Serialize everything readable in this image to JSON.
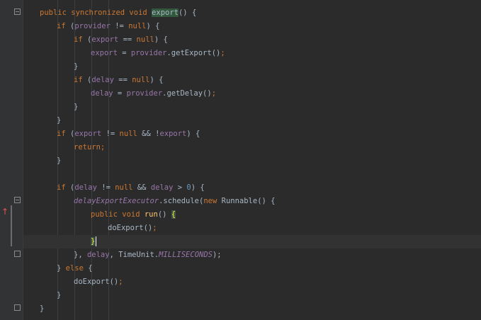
{
  "editor": {
    "colors": {
      "background": "#2b2b2b",
      "keyword": "#cc7832",
      "field": "#9876aa",
      "number": "#6897bb",
      "plain": "#a9b7c6",
      "highlight": "#32593d"
    },
    "gutter_icons": [
      "fold-marker-icon",
      "override-method-icon"
    ],
    "lines": [
      [
        {
          "t": "public synchronized void ",
          "c": "keyword"
        },
        {
          "t": "export",
          "c": "highlight"
        },
        {
          "t": "() {",
          "c": "plain"
        }
      ],
      [
        {
          "t": "if",
          "c": "keyword"
        },
        {
          "t": " (",
          "c": "plain"
        },
        {
          "t": "provider",
          "c": "field"
        },
        {
          "t": " != ",
          "c": "plain"
        },
        {
          "t": "null",
          "c": "keyword"
        },
        {
          "t": ") {",
          "c": "plain"
        }
      ],
      [
        {
          "t": "if",
          "c": "keyword"
        },
        {
          "t": " (",
          "c": "plain"
        },
        {
          "t": "export",
          "c": "field"
        },
        {
          "t": " == ",
          "c": "plain"
        },
        {
          "t": "null",
          "c": "keyword"
        },
        {
          "t": ") {",
          "c": "plain"
        }
      ],
      [
        {
          "t": "export",
          "c": "field"
        },
        {
          "t": " = ",
          "c": "plain"
        },
        {
          "t": "provider",
          "c": "field"
        },
        {
          "t": ".getExport()",
          "c": "plain"
        },
        {
          "t": ";",
          "c": "keyword"
        }
      ],
      [
        {
          "t": "}",
          "c": "plain"
        }
      ],
      [
        {
          "t": "if",
          "c": "keyword"
        },
        {
          "t": " (",
          "c": "plain"
        },
        {
          "t": "delay",
          "c": "field"
        },
        {
          "t": " == ",
          "c": "plain"
        },
        {
          "t": "null",
          "c": "keyword"
        },
        {
          "t": ") {",
          "c": "plain"
        }
      ],
      [
        {
          "t": "delay",
          "c": "field"
        },
        {
          "t": " = ",
          "c": "plain"
        },
        {
          "t": "provider",
          "c": "field"
        },
        {
          "t": ".getDelay()",
          "c": "plain"
        },
        {
          "t": ";",
          "c": "keyword"
        }
      ],
      [
        {
          "t": "}",
          "c": "plain"
        }
      ],
      [
        {
          "t": "}",
          "c": "plain"
        }
      ],
      [
        {
          "t": "if",
          "c": "keyword"
        },
        {
          "t": " (",
          "c": "plain"
        },
        {
          "t": "export",
          "c": "field"
        },
        {
          "t": " != ",
          "c": "plain"
        },
        {
          "t": "null",
          "c": "keyword"
        },
        {
          "t": " && !",
          "c": "plain"
        },
        {
          "t": "export",
          "c": "field"
        },
        {
          "t": ") {",
          "c": "plain"
        }
      ],
      [
        {
          "t": "return;",
          "c": "keyword"
        }
      ],
      [
        {
          "t": "}",
          "c": "plain"
        }
      ],
      [],
      [
        {
          "t": "if",
          "c": "keyword"
        },
        {
          "t": " (",
          "c": "plain"
        },
        {
          "t": "delay",
          "c": "field"
        },
        {
          "t": " != ",
          "c": "plain"
        },
        {
          "t": "null",
          "c": "keyword"
        },
        {
          "t": " && ",
          "c": "plain"
        },
        {
          "t": "delay",
          "c": "field"
        },
        {
          "t": " > ",
          "c": "plain"
        },
        {
          "t": "0",
          "c": "number"
        },
        {
          "t": ") {",
          "c": "plain"
        }
      ],
      [
        {
          "t": "delayExportExecutor",
          "c": "static"
        },
        {
          "t": ".schedule(",
          "c": "plain"
        },
        {
          "t": "new",
          "c": "keyword"
        },
        {
          "t": " Runnable() {",
          "c": "plain"
        }
      ],
      [
        {
          "t": "public void ",
          "c": "keyword"
        },
        {
          "t": "run",
          "c": "method"
        },
        {
          "t": "() ",
          "c": "plain"
        },
        {
          "t": "{",
          "c": "brace"
        }
      ],
      [
        {
          "t": "doExport()",
          "c": "plain"
        },
        {
          "t": ";",
          "c": "keyword"
        }
      ],
      [
        {
          "t": "}",
          "c": "brace"
        }
      ],
      [
        {
          "t": "}, ",
          "c": "plain"
        },
        {
          "t": "delay",
          "c": "field"
        },
        {
          "t": ", TimeUnit.",
          "c": "plain"
        },
        {
          "t": "MILLISECONDS",
          "c": "static"
        },
        {
          "t": ");",
          "c": "plain"
        }
      ],
      [
        {
          "t": "} ",
          "c": "plain"
        },
        {
          "t": "else",
          "c": "keyword"
        },
        {
          "t": " {",
          "c": "plain"
        }
      ],
      [
        {
          "t": "doExport()",
          "c": "plain"
        },
        {
          "t": ";",
          "c": "keyword"
        }
      ],
      [
        {
          "t": "}",
          "c": "plain"
        }
      ],
      [
        {
          "t": "}",
          "c": "plain"
        }
      ]
    ]
  }
}
